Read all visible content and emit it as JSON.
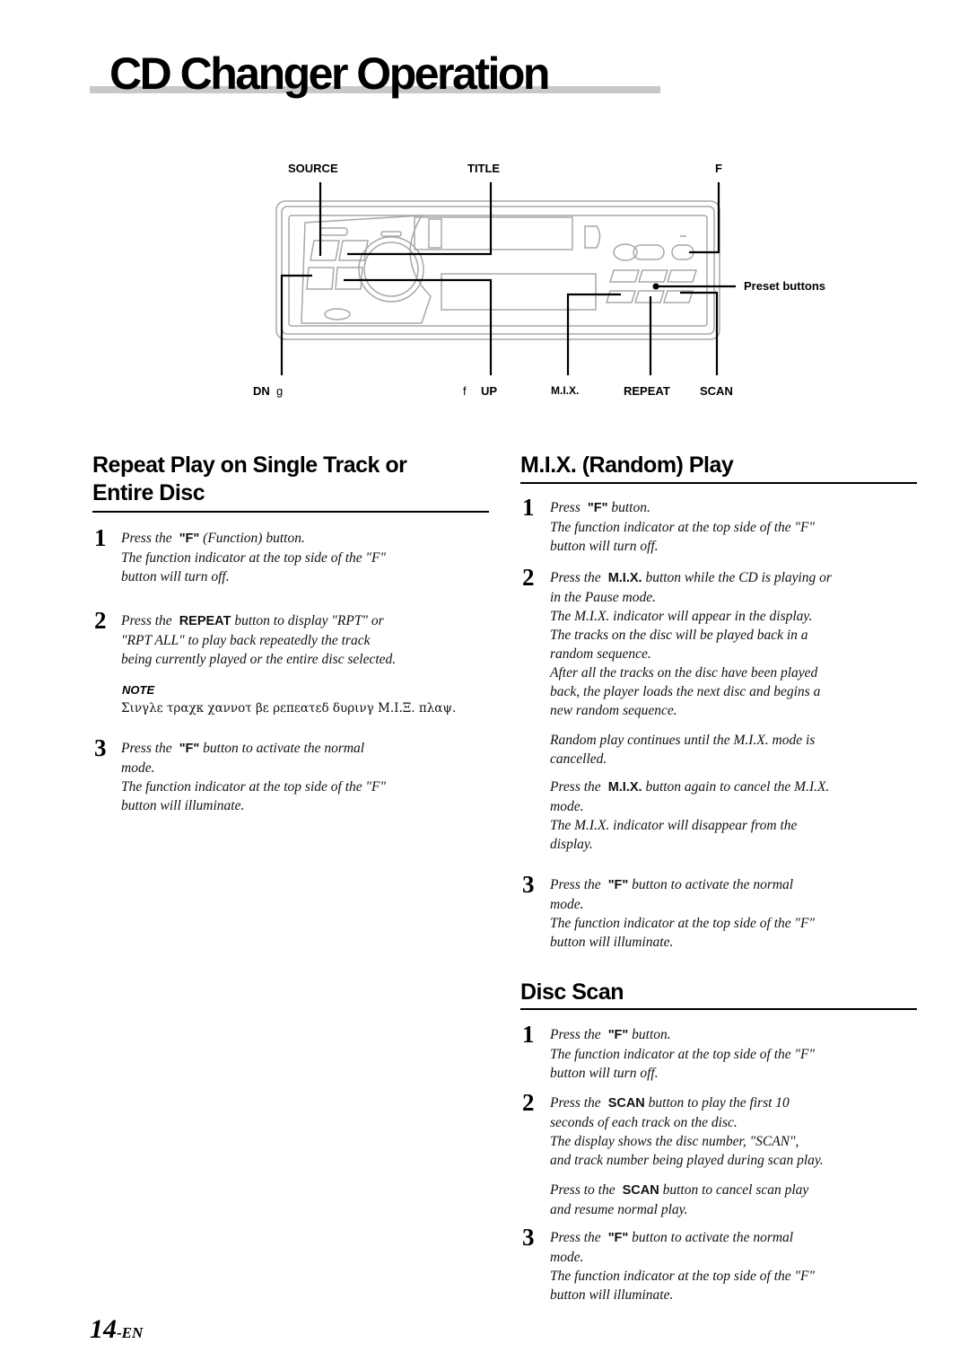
{
  "page": {
    "title": "CD Changer Operation",
    "page_number": "14",
    "page_suffix": "-EN"
  },
  "diagram": {
    "labels": {
      "source": "SOURCE",
      "title": "TITLE",
      "f": "F",
      "preset_buttons": "Preset buttons",
      "dn": "DN",
      "dn_glyph": "g",
      "up_glyph": "f",
      "up": "UP",
      "mix": "M.I.X.",
      "repeat": "REPEAT",
      "scan": "SCAN"
    }
  },
  "sections": {
    "repeat": {
      "title_line1": "Repeat Play on Single Track or",
      "title_line2": "Entire Disc",
      "steps": [
        {
          "number": "1",
          "pre": "Press the",
          "key": "\"F\"",
          "post": " (Function) button.",
          "lines": [
            "The function indicator at the top side of the \"F\"",
            "button will turn off."
          ]
        },
        {
          "number": "2",
          "pre": "Press the",
          "key": "REPEAT",
          "post": " button to display \"RPT\" or",
          "lines": [
            "\"RPT ALL\" to play back repeatedly the track",
            "being currently played or the entire disc selected."
          ]
        },
        {
          "number": "3",
          "pre": "Press the",
          "key": "\"F\"",
          "post": " button to activate the normal",
          "lines": [
            "mode.",
            "The function indicator at the top side of the \"F\"",
            "button will illuminate."
          ]
        }
      ],
      "note_label": "NOTE",
      "note_text": "Σινγλε τραχκ χαννοτ βε ρεπεατεδ δυρινγ Μ.Ι.Ξ. πλαψ."
    },
    "mix": {
      "title": "M.I.X. (Random) Play",
      "steps": [
        {
          "number": "1",
          "pre": "Press",
          "key": "\"F\"",
          "post": " button.",
          "lines": [
            "The function indicator at the top side of the \"F\"",
            "button will turn off."
          ]
        },
        {
          "number": "2",
          "pre": "Press the",
          "key": "M.I.X.",
          "post": " button while the CD is playing or",
          "lines": [
            "in the Pause mode.",
            "The M.I.X. indicator will appear in the display.",
            "The tracks on the disc will be played back in a",
            "random sequence.",
            "After all the tracks on the disc have been played",
            "back, the player loads the next disc and begins a",
            "new random sequence."
          ],
          "extra1": [
            "Random play continues until the M.I.X. mode is",
            "cancelled."
          ],
          "extra2_pre": "Press the",
          "extra2_key": "M.I.X.",
          "extra2_post": " button again to cancel the M.I.X.",
          "extra2_lines": [
            "mode.",
            "The M.I.X. indicator will disappear from the",
            "display."
          ]
        },
        {
          "number": "3",
          "pre": "Press the",
          "key": "\"F\"",
          "post": " button to activate the normal",
          "lines": [
            "mode.",
            "The function indicator at the top side of the \"F\"",
            "button will illuminate."
          ]
        }
      ]
    },
    "scan": {
      "title": "Disc Scan",
      "steps": [
        {
          "number": "1",
          "pre": "Press the",
          "key": "\"F\"",
          "post": " button.",
          "lines": [
            "The function indicator at the top side of the \"F\"",
            "button will turn off."
          ]
        },
        {
          "number": "2",
          "pre": "Press the",
          "key": "SCAN",
          "post": " button to play the first 10",
          "lines": [
            "seconds of each track on the disc.",
            "The display shows the disc number, \"SCAN\",",
            "and track number being played during scan play."
          ],
          "extra_pre": "Press to the",
          "extra_key": "SCAN",
          "extra_post": " button to cancel scan play",
          "extra_lines": [
            "and resume normal play."
          ]
        },
        {
          "number": "3",
          "pre": "Press the",
          "key": "\"F\"",
          "post": " button to activate the normal",
          "lines": [
            "mode.",
            "The function indicator at the top side of the \"F\"",
            "button will illuminate."
          ]
        }
      ]
    }
  }
}
